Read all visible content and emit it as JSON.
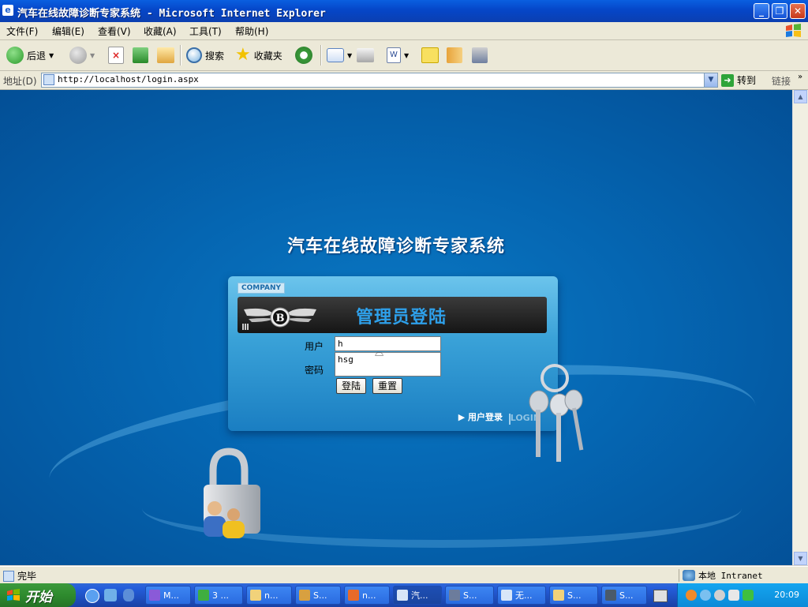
{
  "window": {
    "title": "汽车在线故障诊断专家系统 - Microsoft Internet Explorer"
  },
  "menu": [
    "文件(F)",
    "编辑(E)",
    "查看(V)",
    "收藏(A)",
    "工具(T)",
    "帮助(H)"
  ],
  "toolbar": {
    "back": "后退",
    "search": "搜索",
    "favorites": "收藏夹"
  },
  "address": {
    "label": "地址(D)",
    "url": "http://localhost/login.aspx",
    "go": "转到",
    "links": "链接"
  },
  "page": {
    "system_title": "汽车在线故障诊断专家系统",
    "company_tag": "COMPANY",
    "panel_title": "管理员登陆",
    "user_label": "用户",
    "user_value": "h",
    "password_label": "密码",
    "password_value": "hsg",
    "login_button": "登陆",
    "reset_button": "重置",
    "user_login_link": "▶ 用户登录",
    "login_en": "LOGIN"
  },
  "status": {
    "text": "完毕",
    "zone": "本地 Intranet"
  },
  "taskbar": {
    "start": "开始",
    "tasks": [
      "M...",
      "3 ...",
      "n...",
      "S...",
      "n...",
      "汽...",
      "S...",
      "无...",
      "S...",
      "S..."
    ],
    "clock": "20:09"
  },
  "colors": {
    "title_blue": "#0546c8",
    "page_blue": "#0566b2",
    "panel_title": "#2ea0ea"
  }
}
